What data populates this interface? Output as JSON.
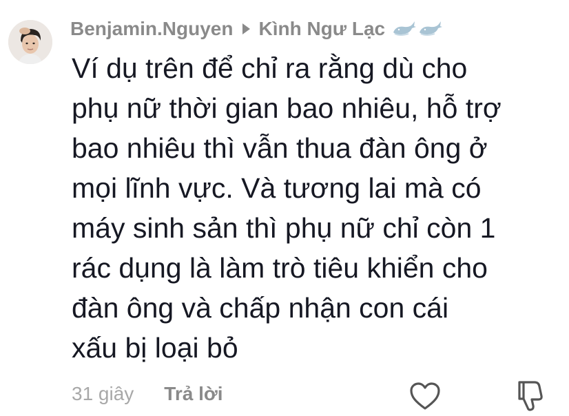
{
  "comment": {
    "username": "Benjamin.Nguyen",
    "reply_to": "Kình Ngư Lạc",
    "text_lines": [
      "Ví dụ trên để chỉ ra rằng dù cho",
      "phụ nữ thời gian bao nhiêu, hỗ trợ",
      "bao nhiêu thì vẫn thua đàn ông ở",
      "mọi lĩnh vực. Và tương lai mà có",
      "máy sinh sản thì phụ nữ chỉ còn 1",
      "rác dụng là làm trò tiêu khiển cho",
      "đàn ông và chấp nhận con cái",
      "xấu bị loại bỏ"
    ],
    "time": "31 giây",
    "reply_label": "Trả lời"
  },
  "icons": {
    "reply_indicator": "triangle-right-icon",
    "badges": [
      "whale-icon",
      "whale-icon"
    ],
    "like": "heart-outline-icon",
    "dislike": "thumbs-down-outline-icon"
  },
  "colors": {
    "primary_text": "#161823",
    "secondary_text": "#8a8a8a",
    "time_text": "#a8a8a8",
    "badge": "#a9c4d4"
  }
}
